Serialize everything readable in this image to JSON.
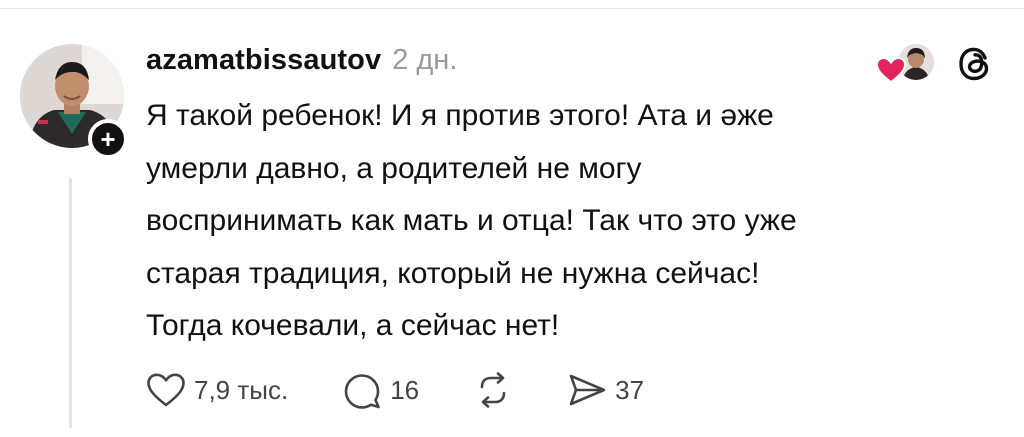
{
  "post": {
    "username": "azamatbissautov",
    "timestamp": "2 дн.",
    "text": "Я такой ребенок! И я против этого! Ата и әже\nумерли давно, а родителей не могу\nвоспринимать как мать и отца! Так что это уже\nстарая традиция, который не нужна сейчас!\nТогда кочевали, а сейчас нет!"
  },
  "actions": {
    "likes": "7,9 тыс.",
    "replies": "16",
    "shares": "37"
  },
  "icons": {
    "avatar": "user-avatar",
    "follow": "plus-icon",
    "liked_by": "heart-icon",
    "app": "threads-logo-icon",
    "like": "heart-outline-icon",
    "reply": "speech-bubble-icon",
    "repost": "repost-icon",
    "share": "paper-plane-icon"
  },
  "colors": {
    "heart_red": "#e0245e",
    "muted_gray": "#9a9a9a",
    "text": "#111111"
  }
}
